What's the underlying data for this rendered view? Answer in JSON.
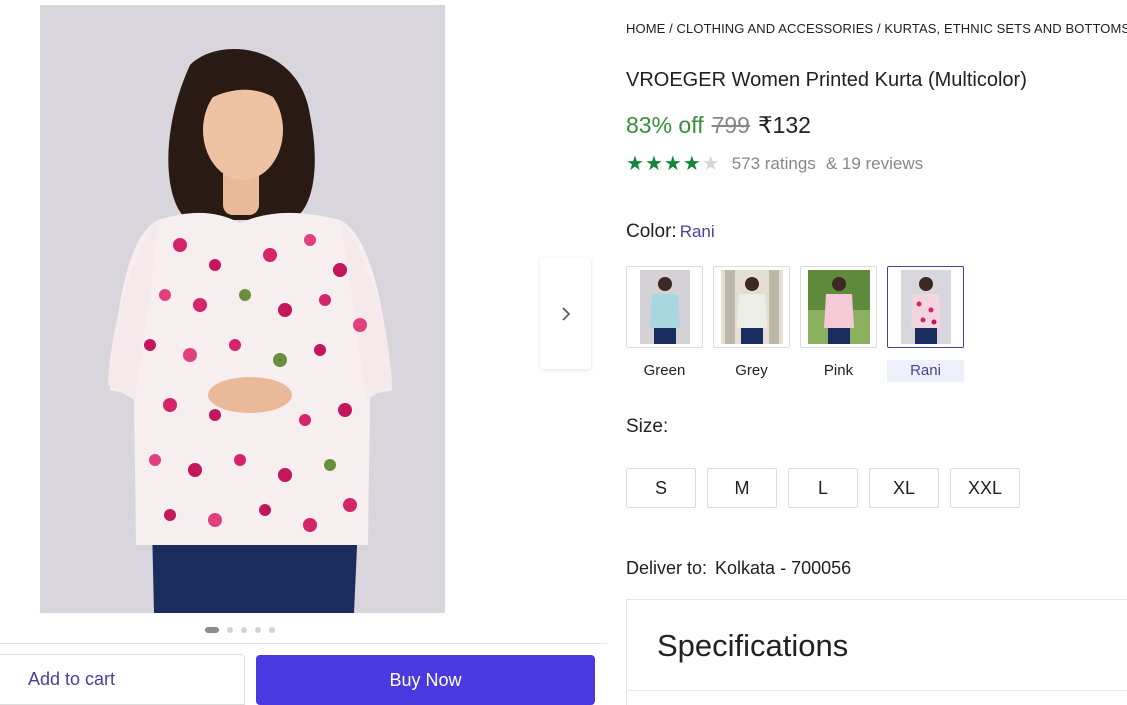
{
  "breadcrumb": "HOME / CLOTHING AND ACCESSORIES / KURTAS, ETHNIC SETS AND BOTTOMS / KU",
  "product": {
    "title": "VROEGER Women Printed Kurta (Multicolor)",
    "discount": "83% off",
    "mrp": "799",
    "price": "₹132",
    "rating": 4,
    "ratings_text": "573 ratings",
    "reviews_text": "& 19 reviews"
  },
  "gallery": {
    "images": 5,
    "active_index": 0
  },
  "color": {
    "label": "Color:",
    "selected": "Rani",
    "options": [
      "Green",
      "Grey",
      "Pink",
      "Rani"
    ]
  },
  "size": {
    "label": "Size:",
    "options": [
      "S",
      "M",
      "L",
      "XL",
      "XXL"
    ]
  },
  "delivery": {
    "label": "Deliver to:",
    "location": "Kolkata - 700056"
  },
  "specifications": {
    "title": "Specifications"
  },
  "actions": {
    "add_to_cart": "Add to cart",
    "buy_now": "Buy Now"
  },
  "colors": {
    "accent": "#4a38e0",
    "discount": "#388e3c",
    "star": "#15853b",
    "link": "#4a3f9e"
  }
}
